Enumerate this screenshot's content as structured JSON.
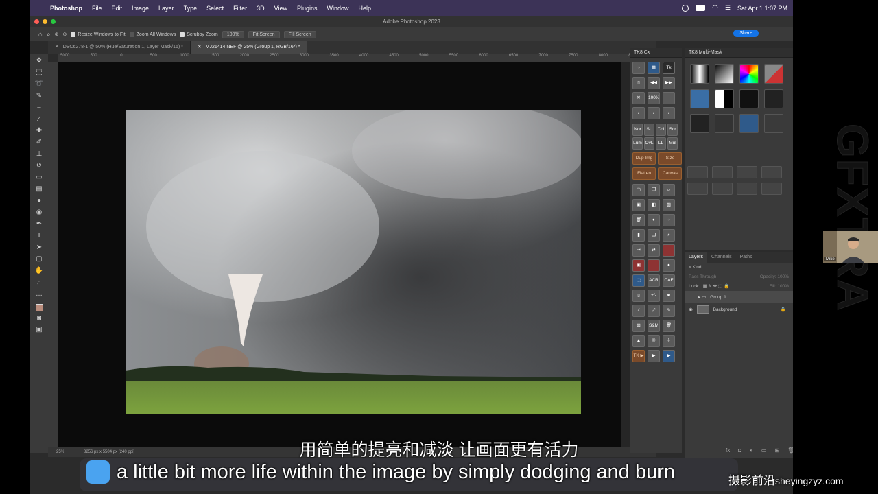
{
  "menubar": {
    "app": "Photoshop",
    "items": [
      "File",
      "Edit",
      "Image",
      "Layer",
      "Type",
      "Select",
      "Filter",
      "3D",
      "View",
      "Plugins",
      "Window",
      "Help"
    ],
    "clock": "Sat Apr 1  1:07 PM"
  },
  "window": {
    "title": "Adobe Photoshop 2023"
  },
  "options": {
    "zoom_pct": "100%",
    "resize_windows": "Resize Windows to Fit",
    "zoom_all": "Zoom All Windows",
    "scrubby": "Scrubby Zoom",
    "fit_screen": "Fit Screen",
    "fill_screen": "Fill Screen",
    "share": "Share"
  },
  "tabs": [
    {
      "label": "_DSC6278-1 @ 50% (Hue/Saturation 1, Layer Mask/16) *"
    },
    {
      "label": "_MJ21414.NEF @ 25% (Group 1, RGB/16*) *"
    }
  ],
  "ruler": [
    "5000",
    "500",
    "0",
    "500",
    "1000",
    "1500",
    "2000",
    "2500",
    "3000",
    "3500",
    "4000",
    "4500",
    "5000",
    "5500",
    "6000",
    "6500",
    "7000",
    "7500",
    "8000",
    "8500"
  ],
  "status": {
    "zoom": "25%",
    "dims": "8256 px x 5504 px (240 ppi)"
  },
  "cx": {
    "title": "TK8 Cx",
    "zoom": "100%",
    "row_a": [
      "Nor",
      "SL",
      "Col",
      "Scr"
    ],
    "row_b": [
      "Lum",
      "OvL",
      "LL",
      "Mul"
    ],
    "dup": "Dup Img",
    "size": "Size",
    "flatten": "Flatten",
    "canvas": "Canvas",
    "acr": "ACR",
    "caf": "CAF",
    "pm": "+/-",
    "sm": "S&M",
    "tk": "TK"
  },
  "mm": {
    "title": "TK8 Multi-Mask"
  },
  "layers": {
    "tabs": [
      "Layers",
      "Channels",
      "Paths"
    ],
    "kind": "Kind",
    "blend": "Pass Through",
    "opacity": "Opacity: 100%",
    "lock": "Lock:",
    "fill": "Fill: 100%",
    "items": [
      {
        "name": "Group 1"
      },
      {
        "name": "Background"
      }
    ]
  },
  "webcam": {
    "name": "Mike"
  },
  "subtitle": {
    "cn": "用简单的提亮和减淡 让画面更有活力",
    "en": "a little bit more life within the image by simply dodging and burn"
  },
  "watermark": {
    "site": "摄影前沿",
    "url": "sheyingzyz.com",
    "side": "GFXTRA"
  },
  "colors": {
    "accent": "#1473e6",
    "menubar": "#3c3357"
  }
}
